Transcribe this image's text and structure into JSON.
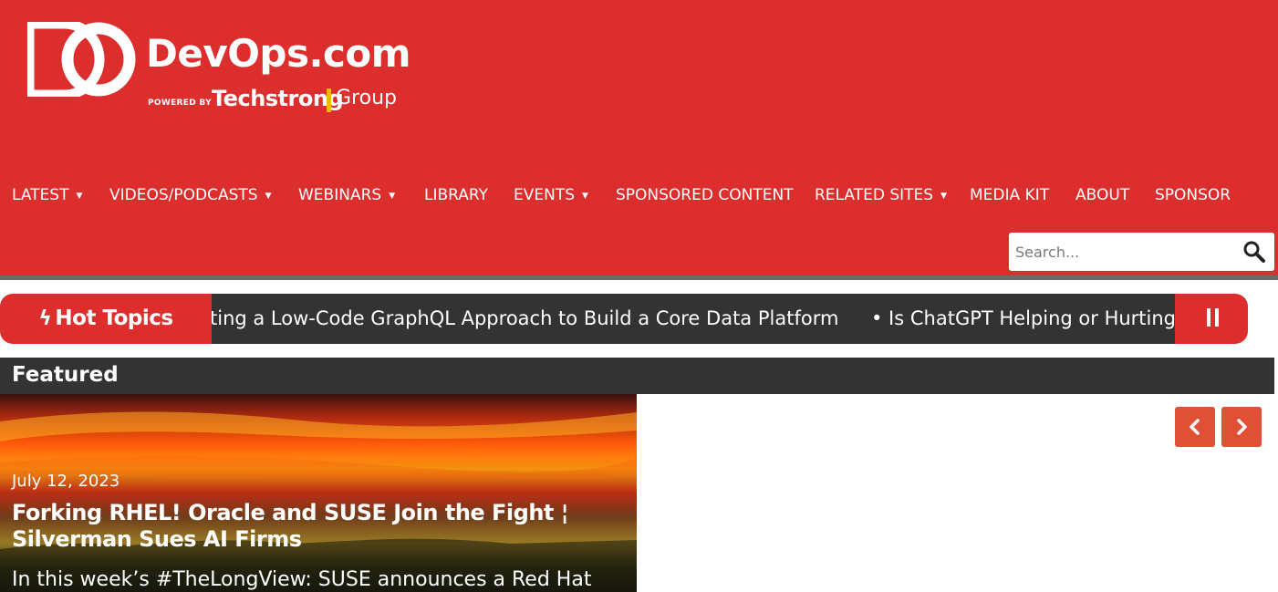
{
  "header": {
    "logo": {
      "title": "DevOps.com",
      "powered_by": "POWERED BY",
      "brand": "Techstrong",
      "group": "Group"
    },
    "nav": [
      {
        "label": "LATEST",
        "dropdown": true
      },
      {
        "label": "VIDEOS/PODCASTS",
        "dropdown": true
      },
      {
        "label": "WEBINARS",
        "dropdown": true
      },
      {
        "label": "LIBRARY",
        "dropdown": false
      },
      {
        "label": "EVENTS",
        "dropdown": true
      },
      {
        "label": "SPONSORED CONTENT",
        "dropdown": false
      },
      {
        "label": "RELATED SITES",
        "dropdown": true
      },
      {
        "label": "MEDIA KIT",
        "dropdown": false
      },
      {
        "label": "ABOUT",
        "dropdown": false
      },
      {
        "label": "SPONSOR",
        "dropdown": false
      }
    ],
    "caret": "▼",
    "search": {
      "placeholder": "Search...",
      "value": ""
    }
  },
  "ticker": {
    "label": "Hot Topics",
    "bolt": "ϟ",
    "items": [
      "ting a Low-Code GraphQL Approach to Build a Core Data Platform",
      "•  Is ChatGPT Helping or Hurting"
    ]
  },
  "featured": {
    "title": "Featured",
    "card": {
      "date": "July 12, 2023",
      "headline": "Forking RHEL! Oracle and SUSE Join the Fight ¦ Silverman Sues AI Firms",
      "excerpt": "In this week’s #TheLongView: SUSE announces a Red Hat"
    }
  },
  "colors": {
    "brand_red": "#dc2e2c",
    "dark": "#333333",
    "accent_orange": "#e05036",
    "techstrong_yellow": "#f5b800"
  },
  "icons": [
    "logo-mark-icon",
    "search-icon",
    "bolt-icon",
    "pause-icon",
    "chevron-left-icon",
    "chevron-right-icon"
  ]
}
